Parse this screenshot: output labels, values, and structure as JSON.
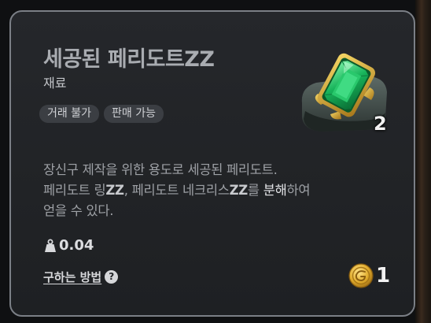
{
  "item": {
    "name": "세공된 페리도트ZZ",
    "category": "재료",
    "tags": [
      "거래 불가",
      "판매 가능"
    ],
    "quantity": "2",
    "description": {
      "line1": "장신구 제작을 위한 용도로 세공된 페리도트.",
      "line2_a": "페리도트 링",
      "line2_b": "ZZ",
      "line2_c": ", 페리도트 네크리스",
      "line2_d": "ZZ",
      "line2_e": "를 ",
      "line2_f": "분해",
      "line2_g": "하여",
      "line3": "얻을 수 있다."
    },
    "weight": "0.04",
    "how_to_obtain": "구하는 방법",
    "price": "1"
  },
  "icons": {
    "weight": "weight-icon",
    "help": "question-icon",
    "coin": "gold-coin-icon",
    "item": "peridot-gem-icon"
  },
  "colors": {
    "gem": "#1db65a",
    "gold": "#d9a92b",
    "border": "#7b7f86",
    "card_bg": "#232529"
  }
}
